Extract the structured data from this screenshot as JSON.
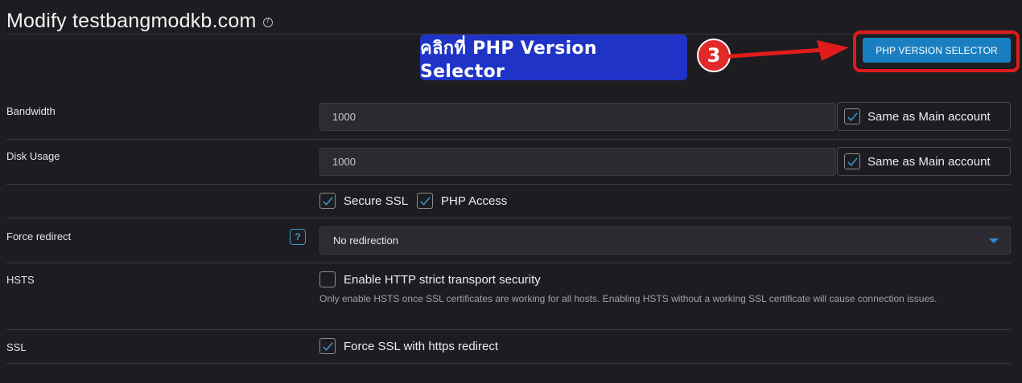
{
  "page": {
    "title": "Modify testbangmodkb.com",
    "title_help_icon": "question-circle-icon"
  },
  "annotation": {
    "callout_text": "คลิกที่ PHP Version Selector",
    "step_number": "3",
    "highlight_color": "#e01b1b"
  },
  "toolbar": {
    "php_version_selector_label": "PHP VERSION SELECTOR",
    "accent": "#1a7fc1"
  },
  "form": {
    "bandwidth": {
      "label": "Bandwidth",
      "value": "1000",
      "same_as_main_label": "Same as Main account",
      "same_as_main_checked": true
    },
    "disk_usage": {
      "label": "Disk Usage",
      "value": "1000",
      "same_as_main_label": "Same as Main account",
      "same_as_main_checked": true
    },
    "options": {
      "secure_ssl_label": "Secure SSL",
      "secure_ssl_checked": true,
      "php_access_label": "PHP Access",
      "php_access_checked": true
    },
    "force_redirect": {
      "label": "Force redirect",
      "help_icon": "question-square-icon",
      "selected": "No redirection"
    },
    "hsts": {
      "label": "HSTS",
      "checkbox_label": "Enable HTTP strict transport security",
      "checked": false,
      "note": "Only enable HSTS once SSL certificates are working for all hosts. Enabling HSTS without a working SSL certificate will cause connection issues."
    },
    "ssl": {
      "label": "SSL",
      "checkbox_label": "Force SSL with https redirect",
      "checked": true
    }
  }
}
